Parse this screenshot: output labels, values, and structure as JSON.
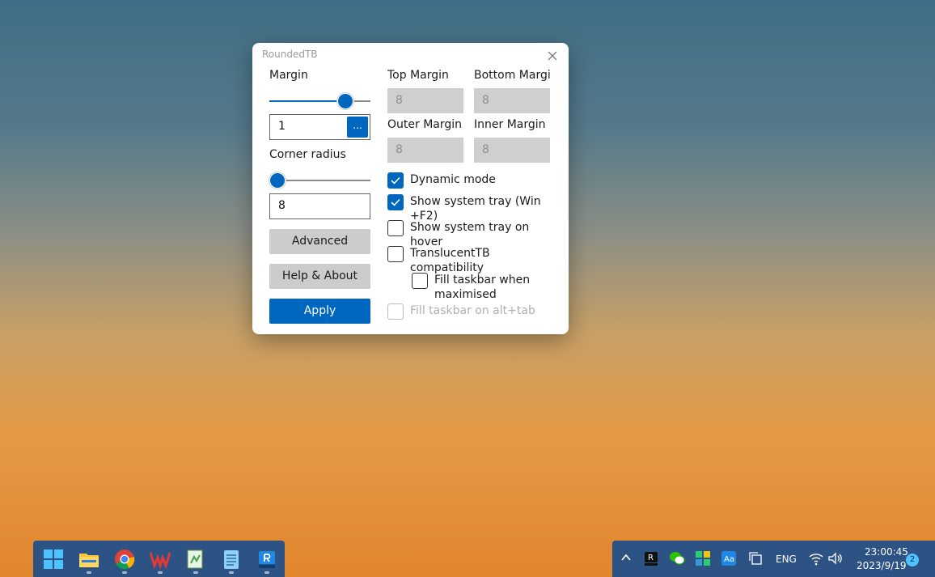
{
  "window": {
    "title": "RoundedTB"
  },
  "left": {
    "margin_label": "Margin",
    "margin_slider": 0.8,
    "margin_value": "1",
    "browse_label": "...",
    "radius_label": "Corner radius",
    "radius_slider": 0.0,
    "radius_value": "8",
    "advanced_label": "Advanced",
    "help_label": "Help & About",
    "apply_label": "Apply"
  },
  "margins": {
    "top_label": "Top Margin",
    "top_value": "8",
    "bottom_label": "Bottom Margi",
    "bottom_value": "8",
    "outer_label": "Outer Margin",
    "outer_value": "8",
    "inner_label": "Inner Margin",
    "inner_value": "8"
  },
  "options": {
    "dynamic_l1": "Dynamic mode",
    "tray_l1": "Show system tray (Win",
    "tray_l2": "+F2)",
    "hover_l1": "Show system tray on",
    "hover_l2": "hover",
    "translucent_l1": "TranslucentTB",
    "translucent_l2": "compatibility",
    "fill_l1": "Fill taskbar when",
    "fill_l2": "maximised",
    "alttab_l1": "Fill taskbar on alt+tab"
  },
  "tray": {
    "language": "ENG",
    "time": "23:00:45",
    "date": "2023/9/19",
    "notifications": "2"
  },
  "colors": {
    "accent": "#0067c0",
    "taskbar": "#2d5384"
  }
}
